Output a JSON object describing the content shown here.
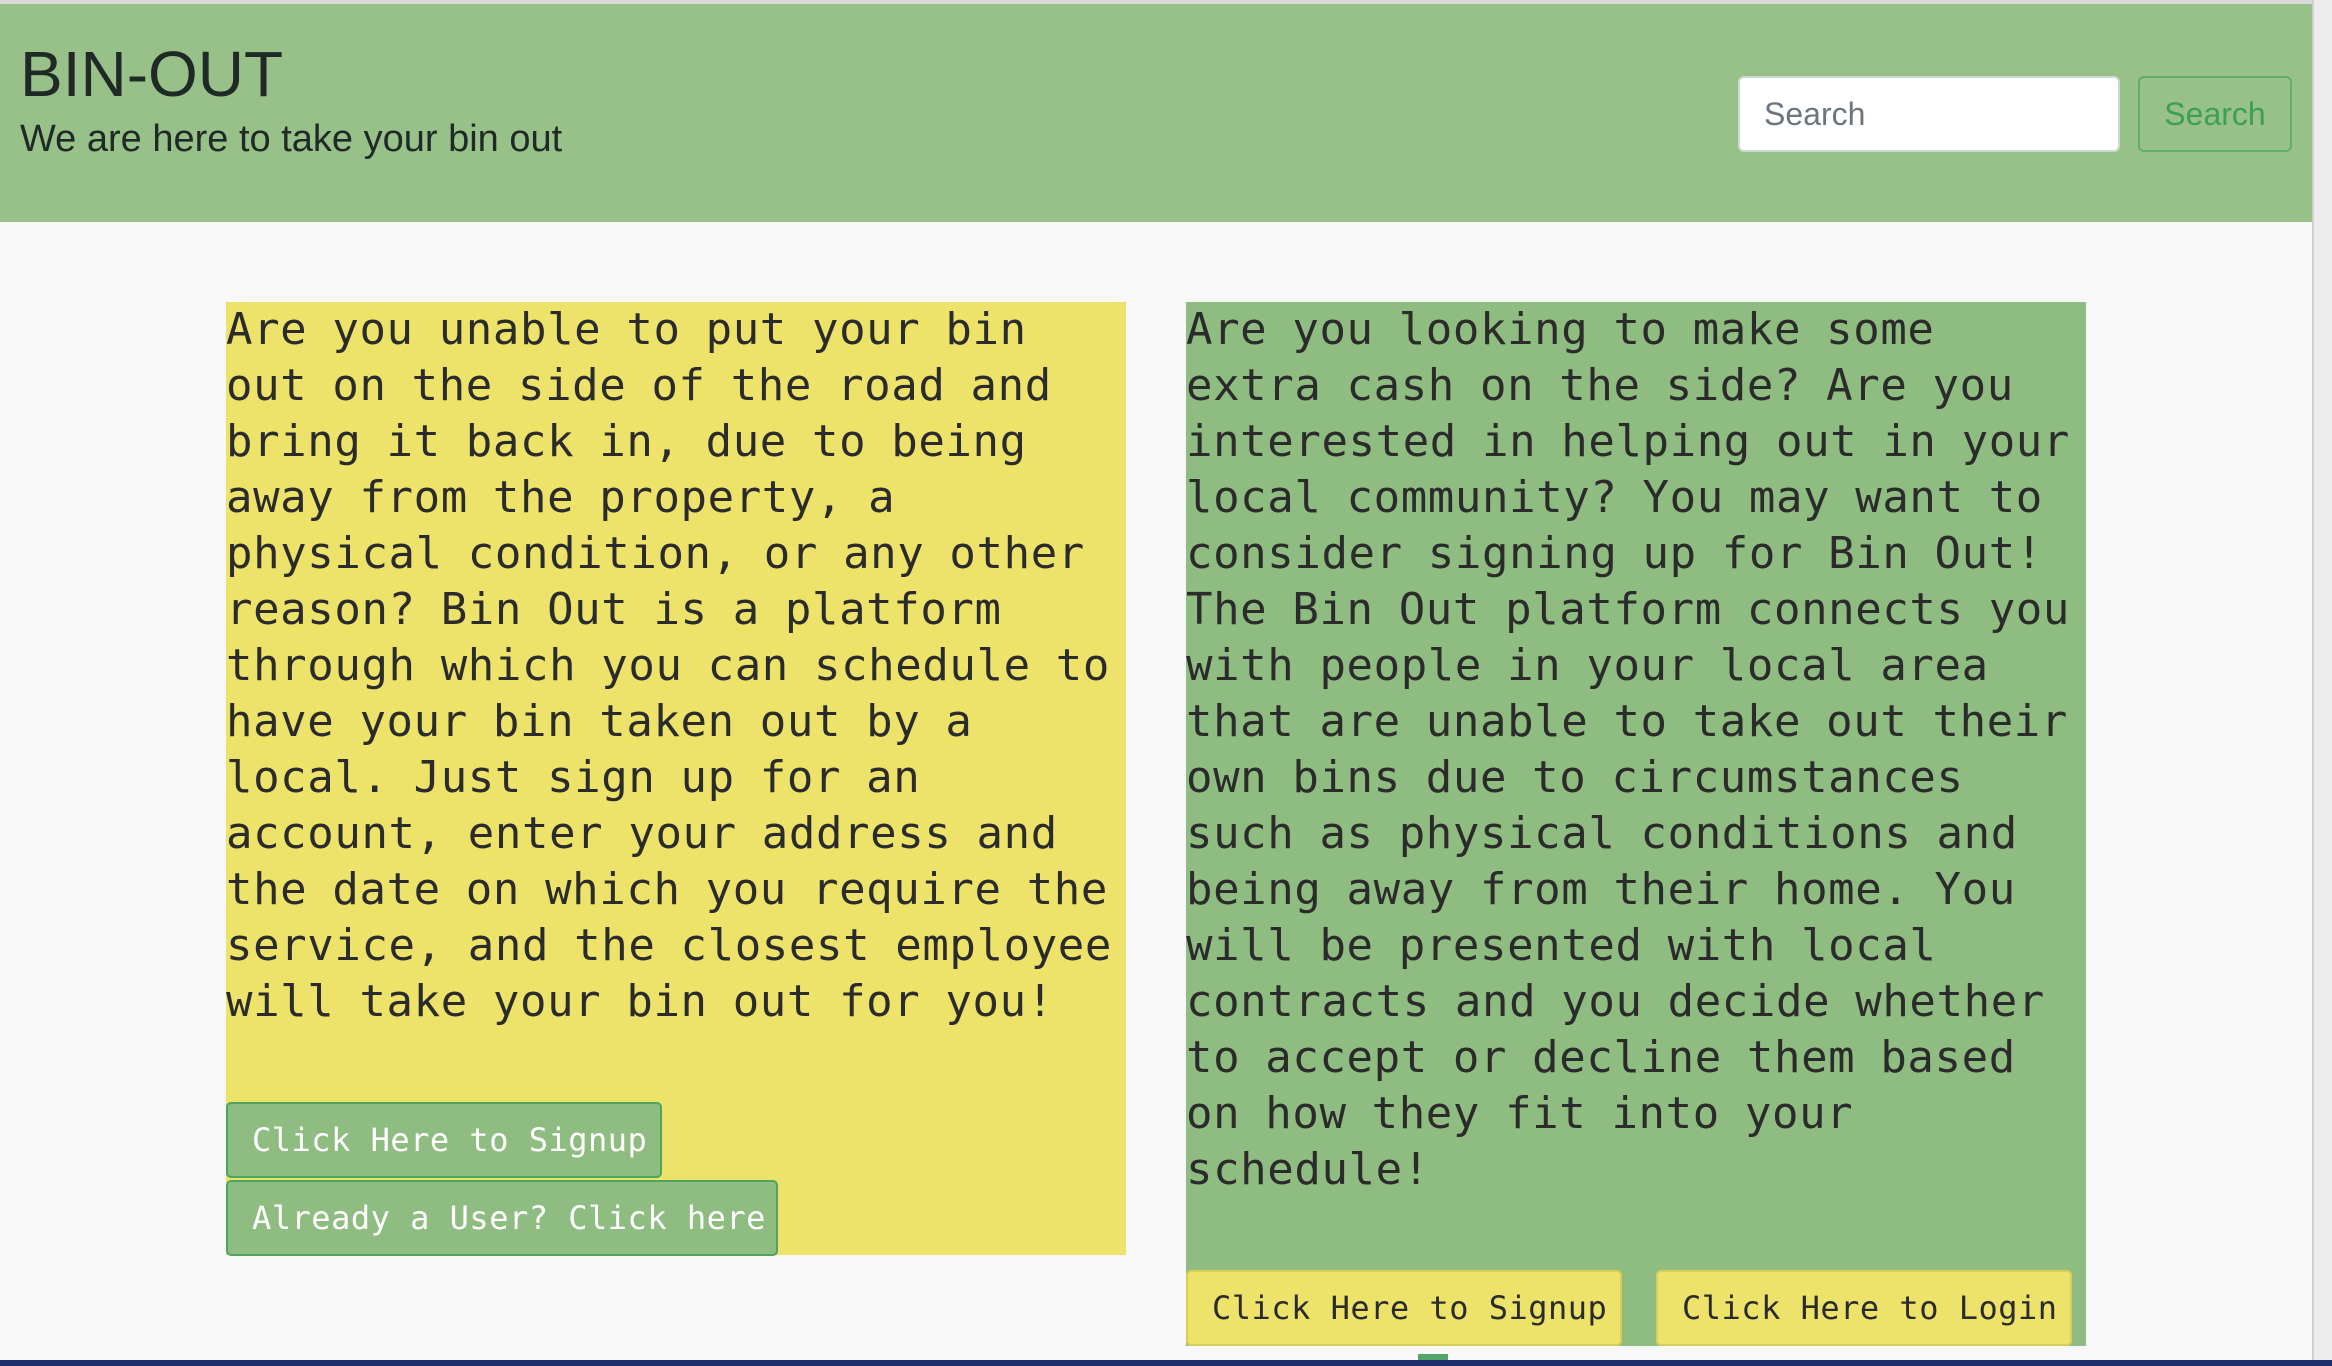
{
  "header": {
    "title": "BIN-OUT",
    "tagline": "We are here to take your bin out",
    "search": {
      "placeholder": "Search",
      "button_label": "Search"
    }
  },
  "cards": {
    "customer": {
      "text": "Are you unable to put your bin out on the side of the road and bring it back in, due to being away from the property, a physical condition, or any other reason? Bin Out is a platform through which you can schedule to have your bin taken out by a local. Just sign up for an account, enter your address and the date on which you require the service, and the closest employee will take your bin out for you!",
      "signup_label": "Click Here to Signup",
      "login_label": "Already a User? Click here"
    },
    "worker": {
      "text": "Are you looking to make some extra cash on the side? Are you interested in helping out in your local community? You may want to consider signing up for Bin Out! The Bin Out platform connects you with people in your local area that are unable to take out their own bins due to circumstances such as physical conditions and being away from their home. You will be presented with local contracts and you decide whether to accept or decline them based on how they fit into your schedule!",
      "signup_label": "Click Here to Signup",
      "login_label": "Click Here to Login"
    }
  },
  "colors": {
    "header_bg": "#97c189",
    "customer_card_bg": "#ede36b",
    "worker_card_bg": "#8fbc80",
    "search_button_accent": "#3d9f54"
  }
}
